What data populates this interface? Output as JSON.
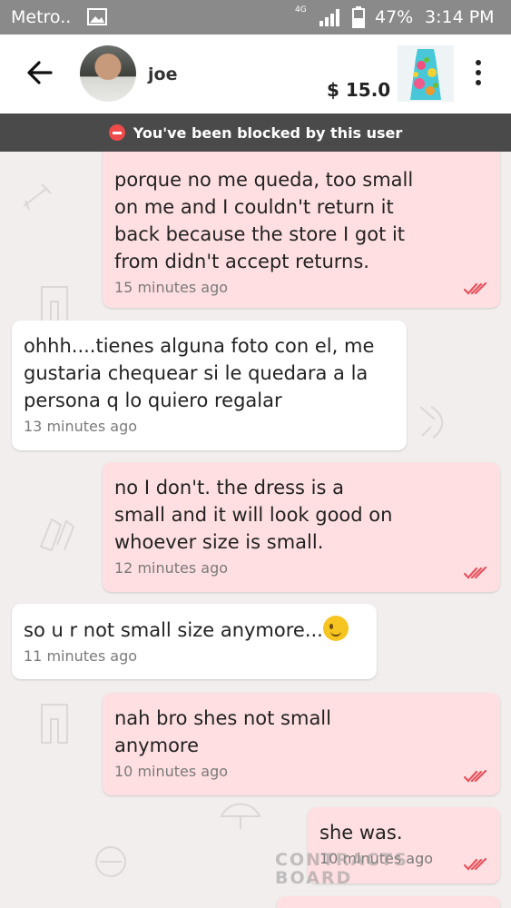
{
  "status_bar": {
    "carrier": "Metro..",
    "network": "4G",
    "battery": "47%",
    "time": "3:14 PM"
  },
  "header": {
    "username": "joe",
    "price": "$ 15.0",
    "avatar_icon": "user-avatar",
    "listing_icon": "floral-dress-thumbnail"
  },
  "banner": {
    "text": "You've been blocked by this user",
    "color": "#4a4a4a",
    "icon_color": "#ef4b4b"
  },
  "colors": {
    "outgoing_bubble": "#ffdfe1",
    "incoming_bubble": "#ffffff",
    "read_ticks": "#e8525d"
  },
  "messages": [
    {
      "direction": "outgoing",
      "text": "porque no me queda, too small\non me and I couldn't return it\nback because the store I got it\nfrom didn't accept returns.",
      "time": "15 minutes ago",
      "read": true
    },
    {
      "direction": "incoming",
      "text": "ohhh....tienes alguna foto con el, me\ngustaria chequear si le quedara a la\npersona q lo quiero regalar",
      "time": "13 minutes ago"
    },
    {
      "direction": "outgoing",
      "text": "no I don't. the dress is a\nsmall and it will look good on\nwhoever size is small.",
      "time": "12 minutes ago",
      "read": true
    },
    {
      "direction": "incoming",
      "text": "so u r not small size anymore...",
      "time": "11 minutes ago",
      "emoji": "winking-smile"
    },
    {
      "direction": "outgoing",
      "text": "nah bro shes not small\nanymore",
      "time": "10 minutes ago",
      "read": true
    },
    {
      "direction": "outgoing",
      "text": "she was.",
      "time": "10 minutes ago",
      "read": true
    }
  ],
  "watermark": "CONTRACTS\nBOARD"
}
